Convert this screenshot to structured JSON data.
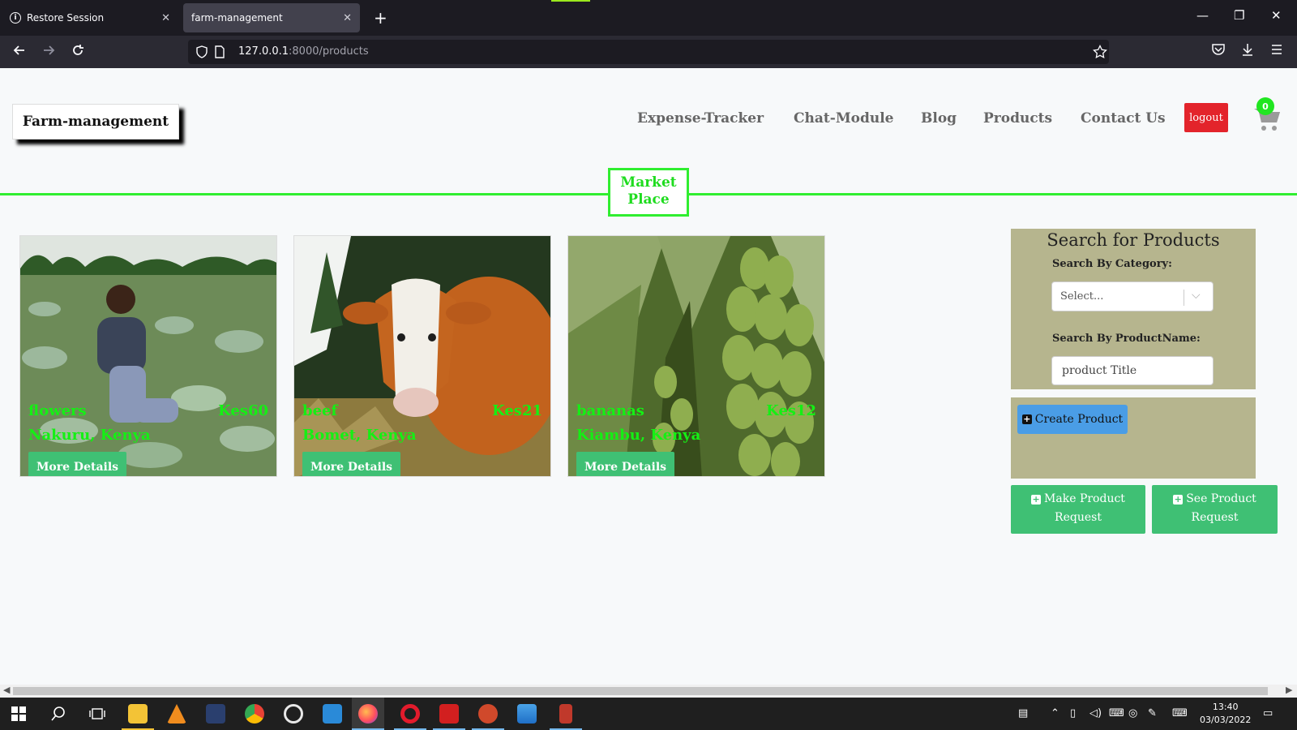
{
  "browser": {
    "tabs": [
      {
        "title": "Restore Session",
        "close": "✕"
      },
      {
        "title": "farm-management",
        "close": "✕"
      }
    ],
    "new_tab": "+",
    "window_controls": {
      "minimize": "—",
      "restore": "❐",
      "close": "✕"
    },
    "url_host": "127.0.0.1",
    "url_rest": ":8000/products",
    "icons": {
      "back": "back-icon",
      "forward": "forward-icon",
      "reload": "reload-icon",
      "bookmark": "star-icon"
    }
  },
  "site": {
    "brand": "Farm-management",
    "nav": [
      "Expense-Tracker",
      "Chat-Module",
      "Blog",
      "Products",
      "Contact Us"
    ],
    "logout": "logout",
    "cart_count": "0",
    "section_title_line1": "Market",
    "section_title_line2": "Place",
    "accent_color": "#30ee30"
  },
  "products": [
    {
      "name": "flowers",
      "price": "Kes60",
      "location": "Nakuru, Kenya",
      "button": "More Details"
    },
    {
      "name": "beef",
      "price": "Kes21",
      "location": "Bomet, Kenya",
      "button": "More Details"
    },
    {
      "name": "bananas",
      "price": "Kes12",
      "location": "Kiambu, Kenya",
      "button": "More Details"
    }
  ],
  "search": {
    "title": "Search for Products",
    "category_label": "Search By Category:",
    "category_value": "Select...",
    "name_label": "Search By ProductName:",
    "name_placeholder": "product Title"
  },
  "actions": {
    "create_product": "Create Product",
    "make_request_line1": "Make Product",
    "make_request_line2": "Request",
    "see_request_line1": "See Product",
    "see_request_line2": "Request"
  },
  "taskbar": {
    "time": "13:40",
    "date": "03/03/2022"
  }
}
